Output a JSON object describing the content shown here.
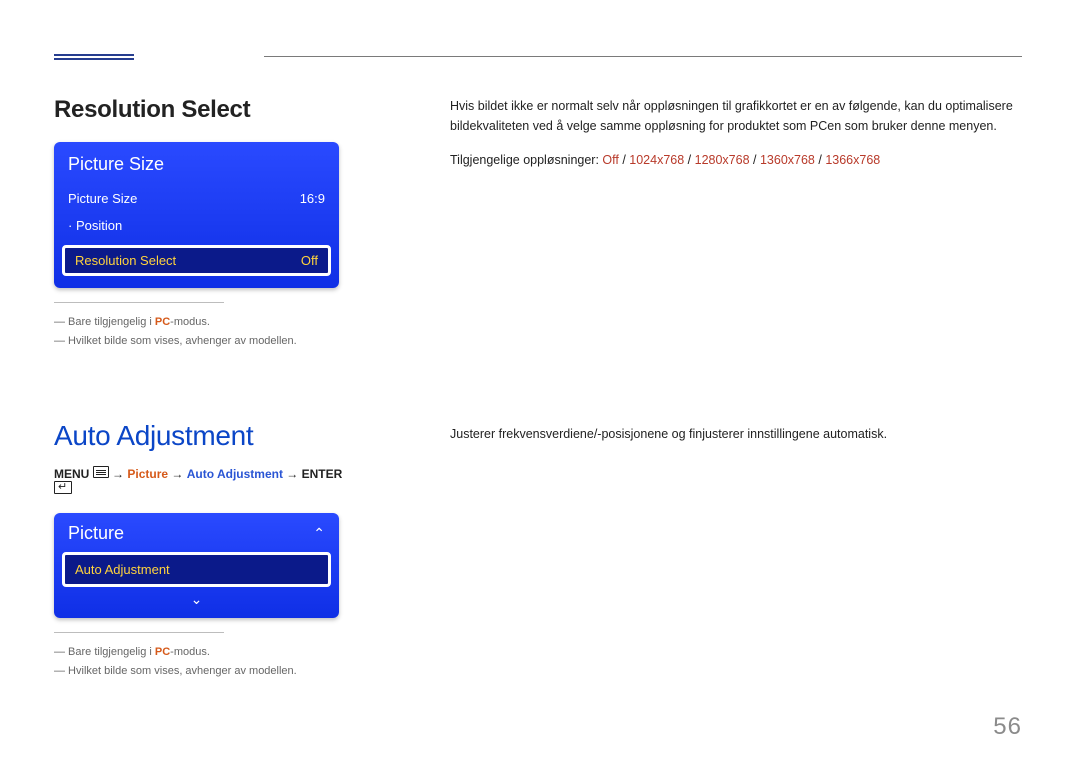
{
  "section1": {
    "heading": "Resolution Select",
    "osd": {
      "title": "Picture Size",
      "row1_label": "Picture Size",
      "row1_value": "16:9",
      "row2_label": "· Position",
      "row3_label": "Resolution Select",
      "row3_value": "Off"
    },
    "notes": {
      "line1_prefix": "― Bare tilgjengelig i ",
      "line1_pc": "PC",
      "line1_suffix": "-modus.",
      "line2": "― Hvilket bilde som vises, avhenger av modellen."
    },
    "body": {
      "para": "Hvis bildet ikke er normalt selv når oppløsningen til grafikkortet er en av følgende, kan du optimalisere bildekvaliteten ved å velge samme oppløsning for produktet som PCen som bruker denne menyen.",
      "res_label": "Tilgjengelige oppløsninger: ",
      "res_off": "Off",
      "res1": "1024x768",
      "res2": "1280x768",
      "res3": "1360x768",
      "res4": "1366x768",
      "slash": " / "
    }
  },
  "section2": {
    "heading": "Auto Adjustment",
    "menupath": {
      "menu": "MENU",
      "arrow": " → ",
      "picture": "Picture",
      "auto": "Auto Adjustment",
      "enter": "ENTER"
    },
    "osd": {
      "title": "Picture",
      "up": "⌃",
      "row_label": "Auto Adjustment",
      "down": "⌄"
    },
    "notes": {
      "line1_prefix": "― Bare tilgjengelig i ",
      "line1_pc": "PC",
      "line1_suffix": "-modus.",
      "line2": "― Hvilket bilde som vises, avhenger av modellen."
    },
    "body": {
      "para": "Justerer frekvensverdiene/-posisjonene og finjusterer innstillingene automatisk."
    }
  },
  "page_number": "56"
}
